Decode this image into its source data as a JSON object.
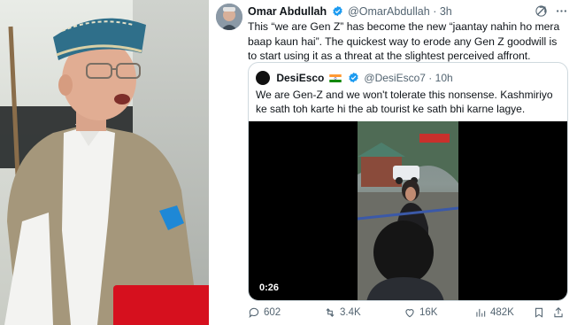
{
  "tweet": {
    "author_name": "Omar Abdullah",
    "author_handle": "@OmarAbdullah",
    "time": "3h",
    "text": "This “we are Gen Z” has become the new “jaantay nahin ho mera baap kaun hai”. The quickest way to erode any Gen Z goodwill is to start using it as a threat at the slightest perceived affront.",
    "separator": "·"
  },
  "quote": {
    "author_name": "DesiEsco",
    "author_handle": "@DesiEsco7",
    "time": "10h",
    "text": "We are Gen-Z and we won't tolerate this nonsense. Kashmiriyo ke sath toh karte hi the ab tourist ke sath bhi karne lagye.",
    "video_duration": "0:26"
  },
  "actions": {
    "replies": "602",
    "reposts": "3.4K",
    "likes": "16K",
    "views": "482K"
  },
  "colors": {
    "verified": "#1d9bf0",
    "muted": "#536471",
    "border": "#cfd9de"
  },
  "icons": [
    "grok-icon",
    "more-icon",
    "reply-icon",
    "repost-icon",
    "like-icon",
    "views-icon",
    "bookmark-icon",
    "share-icon",
    "verified-badge-icon"
  ]
}
